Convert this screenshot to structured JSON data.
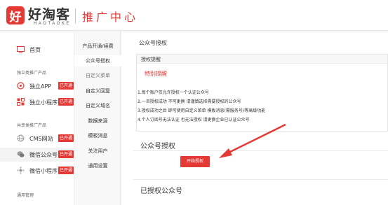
{
  "header": {
    "logo_mark": "好",
    "logo_name": "好淘客",
    "logo_sub": "HAOTAOKE",
    "title": "推广中心"
  },
  "sidebar": {
    "home": {
      "label": "首页",
      "icon": "monitor-icon"
    },
    "section_independent": "独立类推广产品",
    "independent_app": {
      "label": "独立APP",
      "badge": "已开通",
      "icon": "app-icon"
    },
    "independent_mini": {
      "label": "独立小程序",
      "badge": "已开通",
      "icon": "mini-program-icon"
    },
    "section_shared": "共享类推广产品",
    "cms_site": {
      "label": "CMS网站",
      "badge": "已开通",
      "icon": "globe-icon"
    },
    "wechat_official": {
      "label": "微信公众号",
      "badge": "已开通",
      "icon": "wechat-icon"
    },
    "wechat_mini": {
      "label": "微信小程序",
      "badge": "已开通",
      "icon": "mini-program-icon"
    },
    "section_general": "通用管理"
  },
  "subnav": {
    "items": [
      {
        "label": "产品开通/续费"
      },
      {
        "label": "公众号授权"
      },
      {
        "label": "自定义菜单"
      },
      {
        "label": "自定义回复"
      },
      {
        "label": "自定义域名"
      },
      {
        "label": "数据来源"
      },
      {
        "label": "模板消息"
      },
      {
        "label": "关注用户"
      },
      {
        "label": "通用设置"
      }
    ]
  },
  "main": {
    "page_title": "公众号授权",
    "notice": {
      "header": "授权提醒",
      "title": "特别提醒",
      "rules": [
        "1.每个账户仅允许授权一个认证公众号",
        "2.一旦授权成功 不可更换 请谨慎选择需要授权的公众号",
        "3.授权成功之后 即可使用自定义菜单 模板消息(需服务号)等高级功能",
        "4.个人订阅号无法认证 也无法授权 请更换企业已认证公众号"
      ]
    },
    "auth_section_title": "公众号授权",
    "auth_button": "开始授权",
    "authorized_section_title": "已授权公众号"
  },
  "colors": {
    "accent": "#e53935",
    "sidebar_bg": "#ffffff",
    "page_bg": "#f1f1f1"
  }
}
